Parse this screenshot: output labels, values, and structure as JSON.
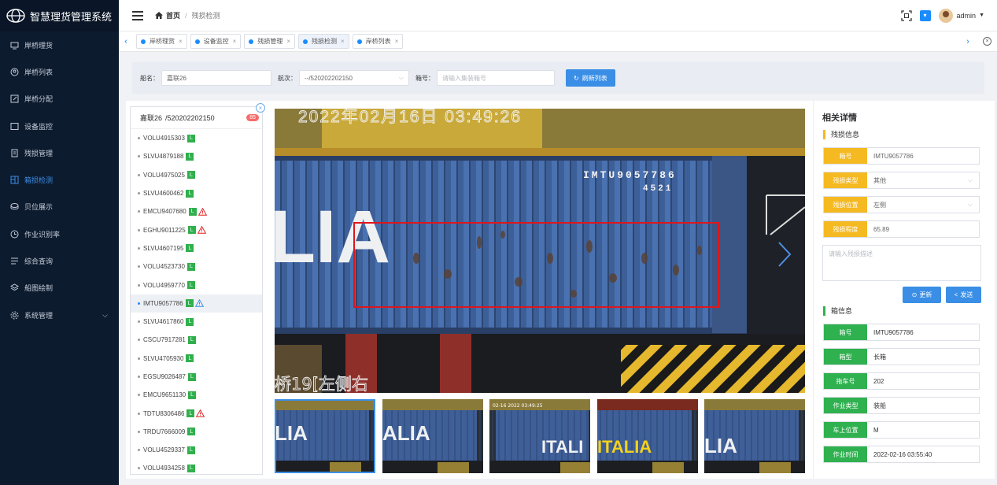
{
  "app": {
    "title": "智慧理货管理系统"
  },
  "sidebar": {
    "items": [
      {
        "label": "岸桥理货",
        "icon": "monitor-icon"
      },
      {
        "label": "岸桥列表",
        "icon": "user-circle-icon"
      },
      {
        "label": "岸桥分配",
        "icon": "edit-icon"
      },
      {
        "label": "设备监控",
        "icon": "screen-icon"
      },
      {
        "label": "残损管理",
        "icon": "document-icon"
      },
      {
        "label": "箱损检测",
        "icon": "detect-icon",
        "active": true
      },
      {
        "label": "贝位展示",
        "icon": "coin-icon"
      },
      {
        "label": "作业识别率",
        "icon": "clock-icon"
      },
      {
        "label": "综合查询",
        "icon": "list-icon"
      },
      {
        "label": "船图绘制",
        "icon": "layers-icon"
      },
      {
        "label": "系统管理",
        "icon": "gear-icon",
        "expandable": true
      }
    ]
  },
  "header": {
    "breadcrumb_home": "首页",
    "breadcrumb_current": "残损检测",
    "username": "admin"
  },
  "tabs": [
    {
      "label": "岸桥理货"
    },
    {
      "label": "设备监控"
    },
    {
      "label": "残损管理"
    },
    {
      "label": "残损检测",
      "active": true
    },
    {
      "label": "岸桥列表"
    }
  ],
  "filter": {
    "ship_label": "船名：",
    "ship_value": "嘉联26",
    "voyage_label": "航次：",
    "voyage_value": "--/520202202150",
    "box_label": "箱号：",
    "box_placeholder": "请输入集装箱号",
    "refresh_label": "刷新列表"
  },
  "list": {
    "header_ship": "嘉联26",
    "header_voyage": "/520202202150",
    "count": "85",
    "tag": "L",
    "items": [
      {
        "id": "VOLU4915303",
        "warn": ""
      },
      {
        "id": "SLVU4879188",
        "warn": ""
      },
      {
        "id": "VOLU4975025",
        "warn": ""
      },
      {
        "id": "SLVU4600462",
        "warn": ""
      },
      {
        "id": "EMCU9407680",
        "warn": "red"
      },
      {
        "id": "EGHU9011225",
        "warn": "red"
      },
      {
        "id": "SLVU4607195",
        "warn": ""
      },
      {
        "id": "VOLU4523730",
        "warn": ""
      },
      {
        "id": "VOLU4959770",
        "warn": ""
      },
      {
        "id": "IMTU9057786",
        "warn": "blue",
        "selected": true
      },
      {
        "id": "SLVU4617860",
        "warn": ""
      },
      {
        "id": "CSCU7917281",
        "warn": ""
      },
      {
        "id": "SLVU4705930",
        "warn": ""
      },
      {
        "id": "EGSU9026487",
        "warn": ""
      },
      {
        "id": "EMCU9651130",
        "warn": ""
      },
      {
        "id": "TDTU8306486",
        "warn": "red"
      },
      {
        "id": "TRDU7666009",
        "warn": ""
      },
      {
        "id": "VOLU4529337",
        "warn": ""
      },
      {
        "id": "VOLU4934258",
        "warn": ""
      }
    ]
  },
  "image": {
    "timestamp": "2022年02月16日 03:49:26",
    "container_code_line1": "IMTU9057786",
    "container_code_line2": "4521",
    "side_text": "LIA",
    "caption": "桥19[左侧右",
    "thumb_texts": [
      "LIA",
      "ALIA",
      "ITALI",
      "ITALIA",
      "LIA"
    ],
    "thumb_timestamp": "02-16 2022 03:49:25"
  },
  "detail": {
    "title": "相关详情",
    "damage_section": "残损信息",
    "damage": [
      {
        "label": "箱号",
        "value": "IMTU9057786",
        "select": false
      },
      {
        "label": "残损类型",
        "value": "其他",
        "select": true
      },
      {
        "label": "残损位置",
        "value": "左侧",
        "select": true
      },
      {
        "label": "残损程度",
        "value": "65.89",
        "select": false
      }
    ],
    "desc_placeholder": "请输入残损描述",
    "update_label": "更新",
    "send_label": "发送",
    "box_section": "箱信息",
    "box": [
      {
        "label": "箱号",
        "value": "IMTU9057786"
      },
      {
        "label": "箱型",
        "value": "长箱"
      },
      {
        "label": "拖车号",
        "value": "202"
      },
      {
        "label": "作业类型",
        "value": "装船"
      },
      {
        "label": "车上位置",
        "value": "M"
      },
      {
        "label": "作业时间",
        "value": "2022-02-16 03:55:40"
      }
    ]
  },
  "colors": {
    "sidebar_bg": "#0d1b2f",
    "accent": "#3a8ee6",
    "damage_label": "#f5b921",
    "box_label": "#2fb14f",
    "count_badge": "#f56c6c",
    "damage_box": "#e0151b"
  }
}
